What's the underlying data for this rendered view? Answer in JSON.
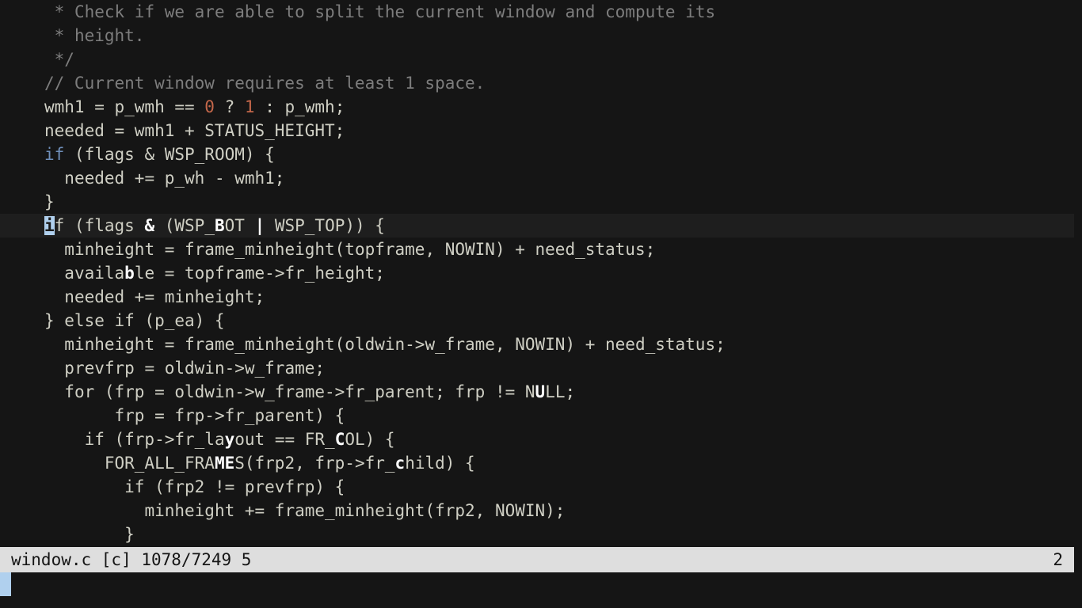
{
  "editor": {
    "app": "vim",
    "colors": {
      "background": "#151515",
      "foreground": "#cfcfc4",
      "comment": "#7d7d7d",
      "keyword": "#6f8fba",
      "number": "#c4674a",
      "bold_match": "#ffffff",
      "cursor": "#b0d0ee",
      "cursorline": "#1e1e1e",
      "statusline_bg": "#dedede",
      "statusline_fg": "#151515"
    },
    "cursor": {
      "line_index": 9,
      "column": 2,
      "char": "i"
    },
    "lines": [
      {
        "indent": " ",
        "cursorline": false,
        "tokens": [
          {
            "text": "* Check if we are able to split the current window and compute its",
            "style": "comment"
          }
        ]
      },
      {
        "indent": " ",
        "cursorline": false,
        "tokens": [
          {
            "text": "* height.",
            "style": "comment"
          }
        ]
      },
      {
        "indent": " ",
        "cursorline": false,
        "tokens": [
          {
            "text": "*/",
            "style": "comment"
          }
        ]
      },
      {
        "indent": "",
        "cursorline": false,
        "tokens": [
          {
            "text": "// Current window requires at least 1 space.",
            "style": "comment"
          }
        ]
      },
      {
        "indent": "",
        "cursorline": false,
        "tokens": [
          {
            "text": "wmh1 = p_wmh == ",
            "style": "normal"
          },
          {
            "text": "0",
            "style": "number"
          },
          {
            "text": " ? ",
            "style": "normal"
          },
          {
            "text": "1",
            "style": "number"
          },
          {
            "text": " : p_wmh;",
            "style": "normal"
          }
        ]
      },
      {
        "indent": "",
        "cursorline": false,
        "tokens": [
          {
            "text": "needed = wmh1 + STATUS_HEIGHT;",
            "style": "normal"
          }
        ]
      },
      {
        "indent": "",
        "cursorline": false,
        "tokens": [
          {
            "text": "if",
            "style": "keyword"
          },
          {
            "text": " (flags & WSP_ROOM) {",
            "style": "normal"
          }
        ]
      },
      {
        "indent": "  ",
        "cursorline": false,
        "tokens": [
          {
            "text": "needed += p_wh - wmh1;",
            "style": "normal"
          }
        ]
      },
      {
        "indent": "",
        "cursorline": false,
        "tokens": [
          {
            "text": "}",
            "style": "normal"
          }
        ]
      },
      {
        "indent": "",
        "cursorline": true,
        "tokens": [
          {
            "text": "i",
            "style": "cursor"
          },
          {
            "text": "f (flags ",
            "style": "normal"
          },
          {
            "text": "&",
            "style": "bold"
          },
          {
            "text": " (WSP_",
            "style": "normal"
          },
          {
            "text": "B",
            "style": "bold"
          },
          {
            "text": "OT ",
            "style": "normal"
          },
          {
            "text": "|",
            "style": "bold"
          },
          {
            "text": " WSP_TOP)) {",
            "style": "normal"
          }
        ]
      },
      {
        "indent": "  ",
        "cursorline": false,
        "tokens": [
          {
            "text": "minheight = frame_minheight(topframe, NOWIN) + need_status;",
            "style": "normal"
          }
        ]
      },
      {
        "indent": "  ",
        "cursorline": false,
        "tokens": [
          {
            "text": "availa",
            "style": "normal"
          },
          {
            "text": "b",
            "style": "bold"
          },
          {
            "text": "le = topframe->fr_height;",
            "style": "normal"
          }
        ]
      },
      {
        "indent": "  ",
        "cursorline": false,
        "tokens": [
          {
            "text": "needed += minheight;",
            "style": "normal"
          }
        ]
      },
      {
        "indent": "",
        "cursorline": false,
        "tokens": [
          {
            "text": "} else if (p_ea) {",
            "style": "normal"
          }
        ]
      },
      {
        "indent": "  ",
        "cursorline": false,
        "tokens": [
          {
            "text": "minheight = frame_minheight(oldwin->w_frame, NOWIN) + need_status;",
            "style": "normal"
          }
        ]
      },
      {
        "indent": "  ",
        "cursorline": false,
        "tokens": [
          {
            "text": "prevfrp = oldwin->w_frame;",
            "style": "normal"
          }
        ]
      },
      {
        "indent": "  ",
        "cursorline": false,
        "tokens": [
          {
            "text": "for (frp = oldwin->w_frame->fr_parent; frp != N",
            "style": "normal"
          },
          {
            "text": "U",
            "style": "bold"
          },
          {
            "text": "LL;",
            "style": "normal"
          }
        ]
      },
      {
        "indent": "       ",
        "cursorline": false,
        "tokens": [
          {
            "text": "frp = frp->fr_parent) {",
            "style": "normal"
          }
        ]
      },
      {
        "indent": "    ",
        "cursorline": false,
        "tokens": [
          {
            "text": "if (frp->fr_la",
            "style": "normal"
          },
          {
            "text": "y",
            "style": "bold"
          },
          {
            "text": "out == FR_",
            "style": "normal"
          },
          {
            "text": "C",
            "style": "bold"
          },
          {
            "text": "OL) {",
            "style": "normal"
          }
        ]
      },
      {
        "indent": "      ",
        "cursorline": false,
        "tokens": [
          {
            "text": "FOR_ALL_FRA",
            "style": "normal"
          },
          {
            "text": "ME",
            "style": "bold"
          },
          {
            "text": "S(frp2, frp->fr_",
            "style": "normal"
          },
          {
            "text": "c",
            "style": "bold"
          },
          {
            "text": "hild) {",
            "style": "normal"
          }
        ]
      },
      {
        "indent": "        ",
        "cursorline": false,
        "tokens": [
          {
            "text": "if (frp2 != prevfrp) {",
            "style": "normal"
          }
        ]
      },
      {
        "indent": "          ",
        "cursorline": false,
        "tokens": [
          {
            "text": "minheight += frame_minheight(frp2, NOWIN);",
            "style": "normal"
          }
        ]
      },
      {
        "indent": "        ",
        "cursorline": false,
        "tokens": [
          {
            "text": "}",
            "style": "normal"
          }
        ]
      }
    ]
  },
  "statusline": {
    "filename": "window.c",
    "filetype": "[c]",
    "position": "1078/7249",
    "column": "5",
    "left_text": "window.c [c] 1078/7249 5",
    "right_text": "2"
  },
  "commandline": {
    "text": "",
    "cursor_visible": true
  }
}
